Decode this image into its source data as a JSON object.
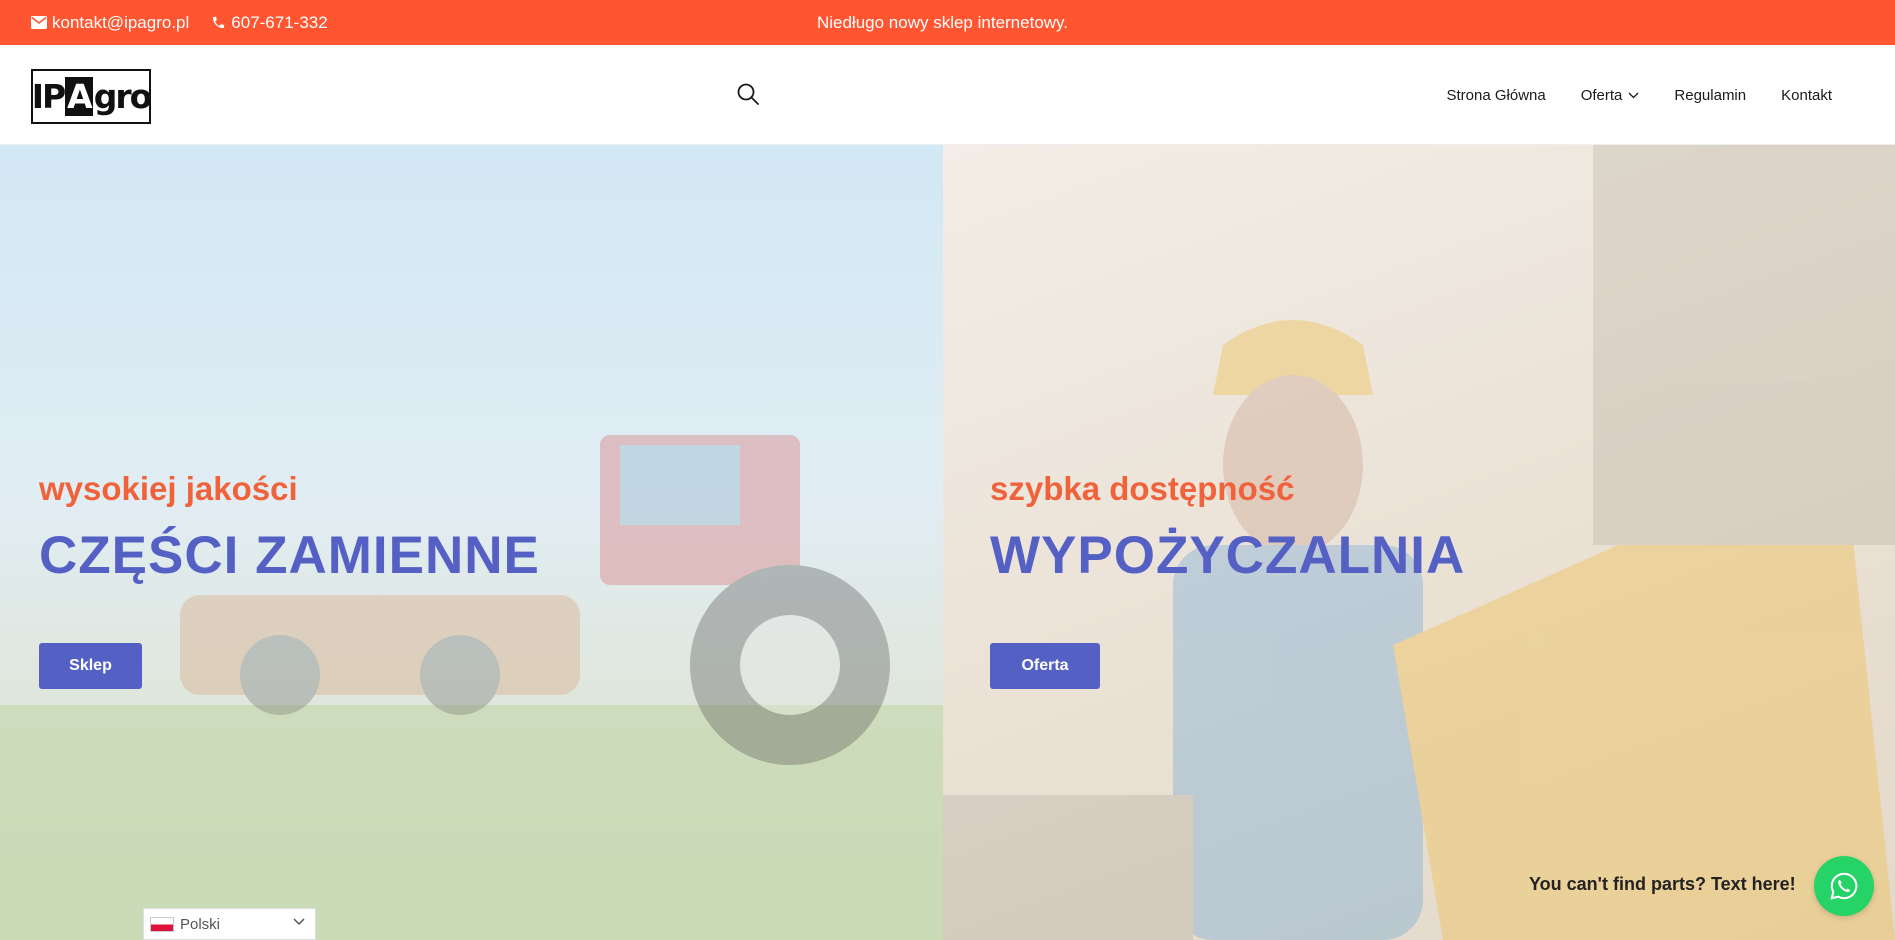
{
  "topbar": {
    "email": "kontakt@ipagro.pl",
    "phone": "607-671-332",
    "announcement": "Niedługo nowy sklep internetowy.",
    "background_color": "#ff5530"
  },
  "header": {
    "logo_text": "IPAgro",
    "nav": [
      {
        "label": "Strona Główna"
      },
      {
        "label": "Oferta",
        "has_dropdown": true
      },
      {
        "label": "Regulamin"
      },
      {
        "label": "Kontakt"
      }
    ]
  },
  "hero": {
    "left": {
      "kicker": "wysokiej jakości",
      "headline": "CZĘŚCI ZAMIENNE",
      "button": "Sklep"
    },
    "right": {
      "kicker": "szybka dostępność",
      "headline": "WYPOŻYCZALNIA",
      "button": "Oferta"
    },
    "accent_color": "#f0623a",
    "primary_color": "#5560c5"
  },
  "language_switcher": {
    "selected": "Polski",
    "flag_icon": "poland-flag-icon"
  },
  "whatsapp": {
    "text": "You can't find parts? Text here!",
    "icon": "whatsapp-icon",
    "color": "#25d366"
  }
}
